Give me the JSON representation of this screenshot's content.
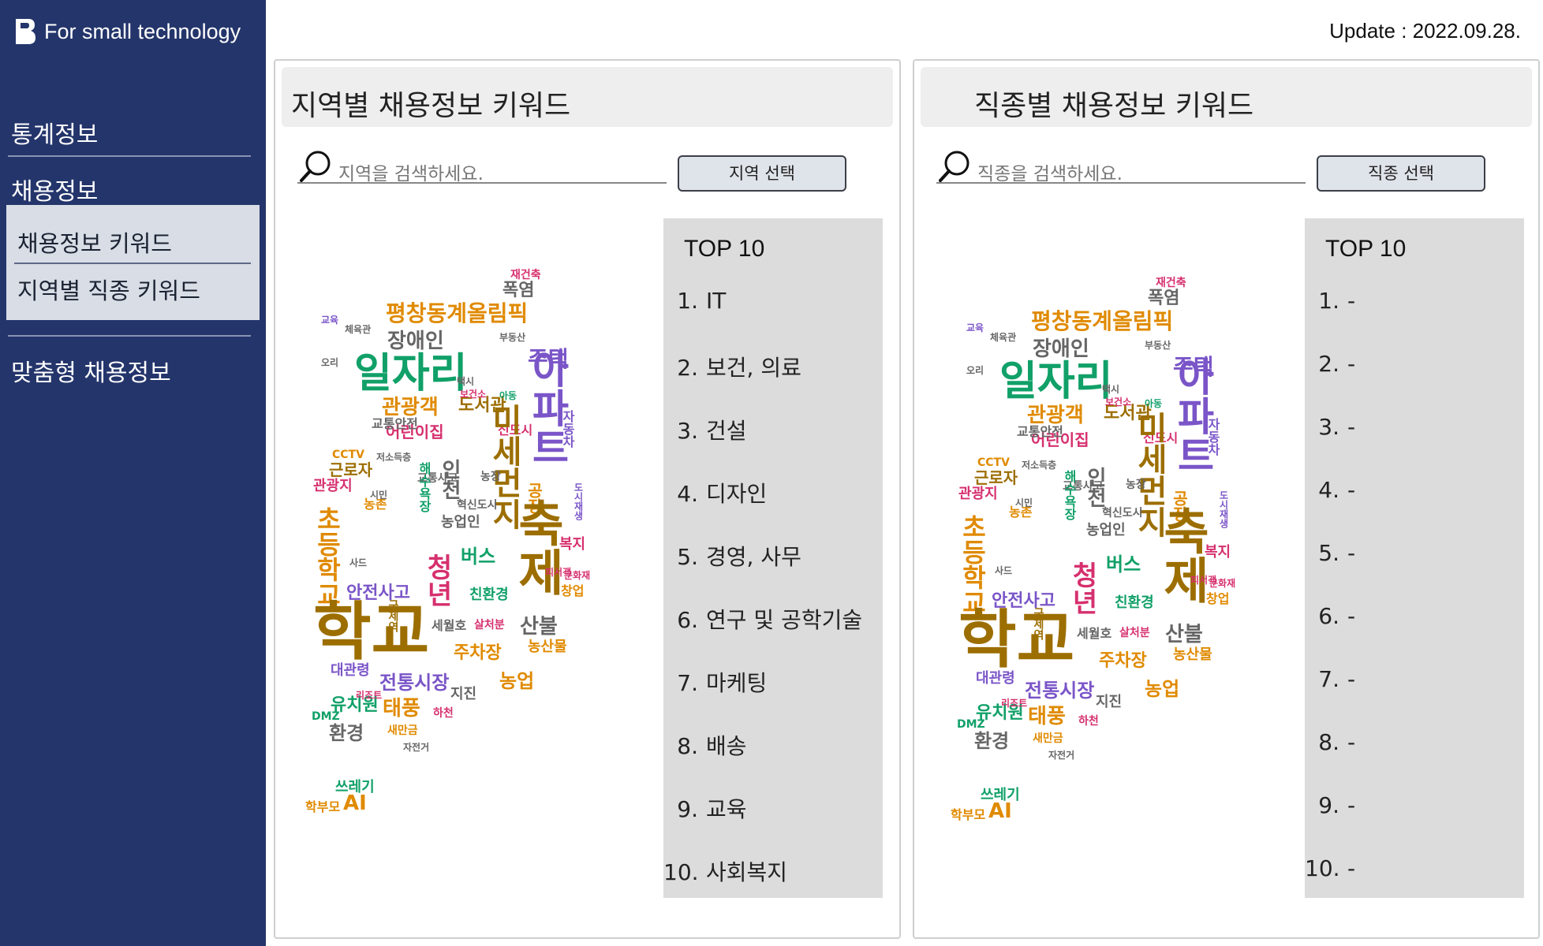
{
  "app": {
    "logo_text": "For small technology",
    "update": "Update : 2022.09.28."
  },
  "sidebar": {
    "stats": "통계정보",
    "jobs": "채용정보",
    "sub1": "채용정보 키워드",
    "sub2": "지역별 직종 키워드",
    "custom": "맞춤형 채용정보"
  },
  "left": {
    "title": "지역별 채용정보 키워드",
    "placeholder": "지역을 검색하세요.",
    "button": "지역 선택",
    "top_title": "TOP 10",
    "top": [
      {
        "n": "1.",
        "v": "IT"
      },
      {
        "n": "2.",
        "v": "보건, 의료"
      },
      {
        "n": "3.",
        "v": "건설"
      },
      {
        "n": "4.",
        "v": "디자인"
      },
      {
        "n": "5.",
        "v": "경영, 사무"
      },
      {
        "n": "6.",
        "v": "연구 및 공학기술"
      },
      {
        "n": "7.",
        "v": "마케팅"
      },
      {
        "n": "8.",
        "v": "배송"
      },
      {
        "n": "9.",
        "v": "교육"
      },
      {
        "n": "10.",
        "v": "사회복지"
      }
    ]
  },
  "right": {
    "title": "직종별 채용정보 키워드",
    "placeholder": "직종을 검색하세요.",
    "button": "직종 선택",
    "top_title": "TOP 10",
    "top": [
      {
        "n": "1.",
        "v": "-"
      },
      {
        "n": "2.",
        "v": "-"
      },
      {
        "n": "3.",
        "v": "-"
      },
      {
        "n": "4.",
        "v": "-"
      },
      {
        "n": "5.",
        "v": "-"
      },
      {
        "n": "6.",
        "v": "-"
      },
      {
        "n": "7.",
        "v": "-"
      },
      {
        "n": "8.",
        "v": "-"
      },
      {
        "n": "9.",
        "v": "-"
      },
      {
        "n": "10.",
        "v": "-"
      }
    ]
  },
  "wordcloud": {
    "colors": {
      "gold": "#c9a000",
      "brown": "#9c6e00",
      "green": "#10a068",
      "purple": "#7a55c8",
      "teal": "#2c8a8a",
      "orange": "#e08a00",
      "magenta": "#d6306e",
      "gray": "#666666"
    },
    "words": [
      {
        "t": "재건축"
      },
      {
        "t": "폭염"
      },
      {
        "t": "평창동계올림픽"
      },
      {
        "t": "장애인"
      },
      {
        "t": "일자리"
      },
      {
        "t": "관광객"
      },
      {
        "t": "도서관"
      },
      {
        "t": "주택"
      },
      {
        "t": "어린이집"
      },
      {
        "t": "신도시"
      },
      {
        "t": "교통안전"
      },
      {
        "t": "CCTV"
      },
      {
        "t": "근로자"
      },
      {
        "t": "관광지"
      },
      {
        "t": "초등학교"
      },
      {
        "t": "아파트"
      },
      {
        "t": "미세먼지"
      },
      {
        "t": "인천"
      },
      {
        "t": "교통사고"
      },
      {
        "t": "농장"
      },
      {
        "t": "농촌"
      },
      {
        "t": "혁신도시"
      },
      {
        "t": "농업인"
      },
      {
        "t": "공장"
      },
      {
        "t": "청년"
      },
      {
        "t": "버스"
      },
      {
        "t": "축제"
      },
      {
        "t": "복지"
      },
      {
        "t": "안전사고"
      },
      {
        "t": "친환경"
      },
      {
        "t": "창업"
      },
      {
        "t": "산불"
      },
      {
        "t": "학교"
      },
      {
        "t": "세월호"
      },
      {
        "t": "살처분"
      },
      {
        "t": "농산물"
      },
      {
        "t": "주차장"
      },
      {
        "t": "대관령"
      },
      {
        "t": "전통시장"
      },
      {
        "t": "농업"
      },
      {
        "t": "지진"
      },
      {
        "t": "유치원"
      },
      {
        "t": "태풍"
      },
      {
        "t": "환경"
      },
      {
        "t": "새만금"
      },
      {
        "t": "하천"
      },
      {
        "t": "DMZ"
      },
      {
        "t": "리조트"
      },
      {
        "t": "자전거"
      },
      {
        "t": "교육"
      },
      {
        "t": "시민"
      },
      {
        "t": "쓰레기"
      },
      {
        "t": "AI"
      },
      {
        "t": "학부모"
      },
      {
        "t": "부동산"
      },
      {
        "t": "오리"
      },
      {
        "t": "아동"
      },
      {
        "t": "보건소"
      },
      {
        "t": "택시"
      },
      {
        "t": "체육관"
      },
      {
        "t": "구제역"
      },
      {
        "t": "피서객"
      },
      {
        "t": "문화재"
      },
      {
        "t": "도시재생"
      },
      {
        "t": "자동차"
      },
      {
        "t": "저소득층"
      },
      {
        "t": "해수욕장"
      },
      {
        "t": "사드"
      }
    ]
  }
}
